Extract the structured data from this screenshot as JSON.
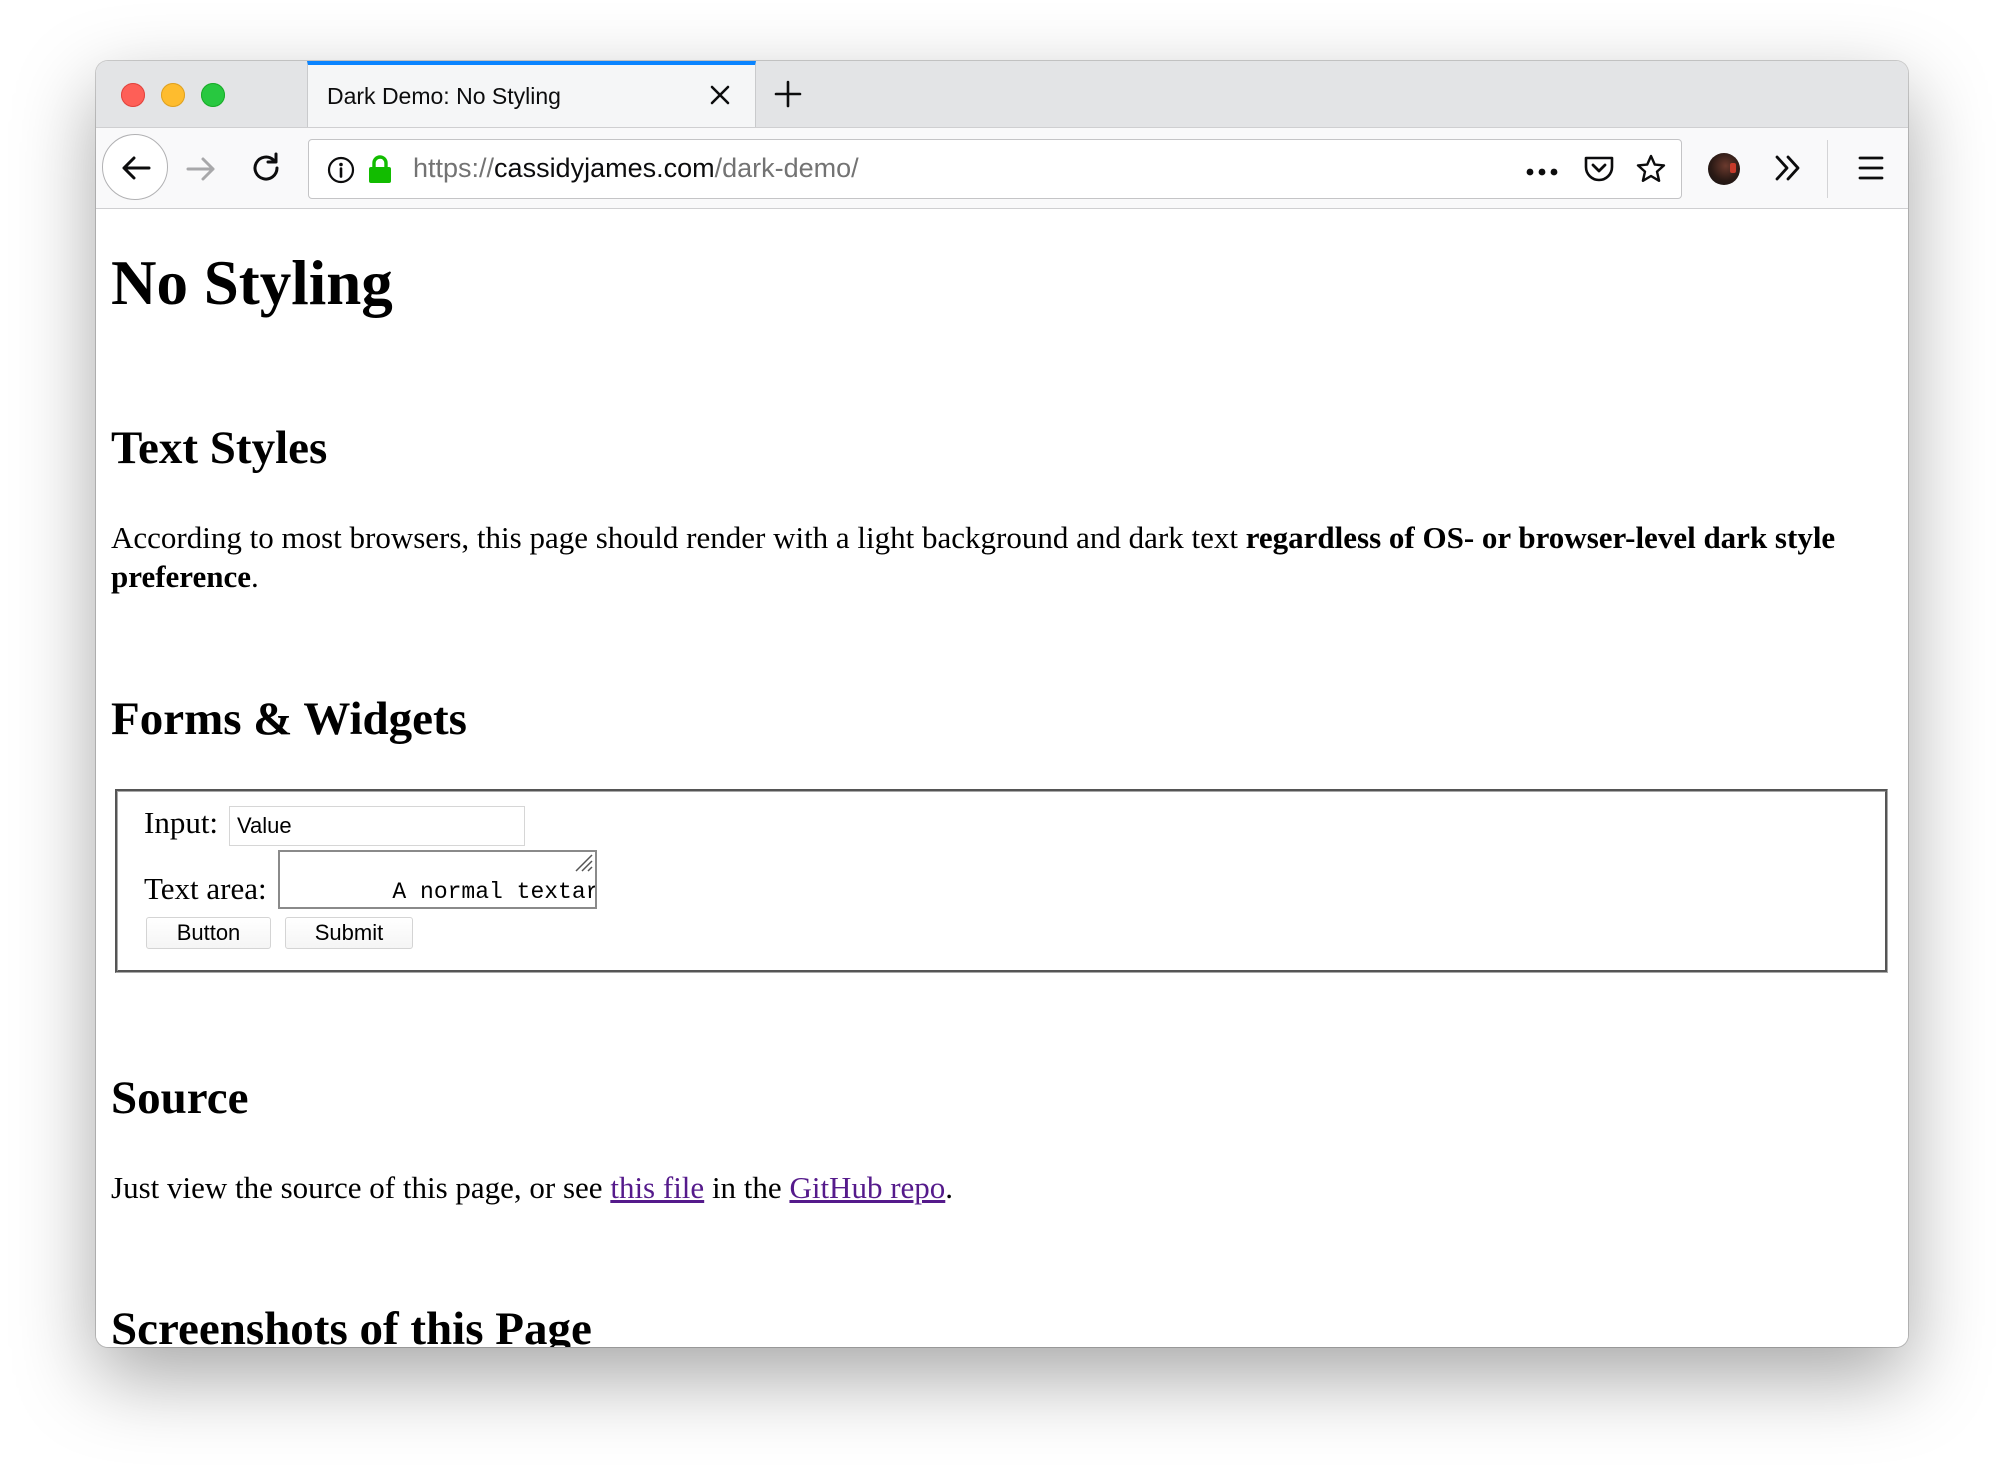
{
  "browser": {
    "tab_title": "Dark Demo: No Styling",
    "url": {
      "scheme": "https://",
      "host": "cassidyjames.com",
      "path": "/dark-demo/"
    },
    "accent_color": "#0a84ff",
    "icons": {
      "tab_close": "close-icon",
      "new_tab": "plus-icon",
      "back": "arrow-left-icon",
      "forward": "arrow-right-icon",
      "reload": "reload-icon",
      "site_info": "info-icon",
      "secure": "lock-icon",
      "page_actions": "more-dots-icon",
      "pocket": "pocket-icon",
      "bookmark": "star-icon",
      "overflow": "chevron-double-right-icon",
      "menu": "hamburger-icon"
    }
  },
  "page": {
    "title": "No Styling",
    "sections": {
      "text_styles": {
        "heading": "Text Styles",
        "text_plain": "According to most browsers, this page should render with a light background and dark text ",
        "text_bold": "regardless of OS- or browser-level dark style preference",
        "text_end": "."
      },
      "forms": {
        "heading": "Forms & Widgets",
        "input_label": "Input:",
        "input_value": "Value",
        "textarea_label": "Text area:",
        "textarea_value": "A normal textarea",
        "button_label": "Button",
        "submit_label": "Submit"
      },
      "source": {
        "heading": "Source",
        "text_before": "Just view the source of this page, or see ",
        "link1": "this file",
        "text_middle": " in the ",
        "link2": "GitHub repo",
        "text_end": ".",
        "link_color": "#551a8b"
      },
      "screenshots": {
        "heading": "Screenshots of this Page"
      }
    }
  }
}
